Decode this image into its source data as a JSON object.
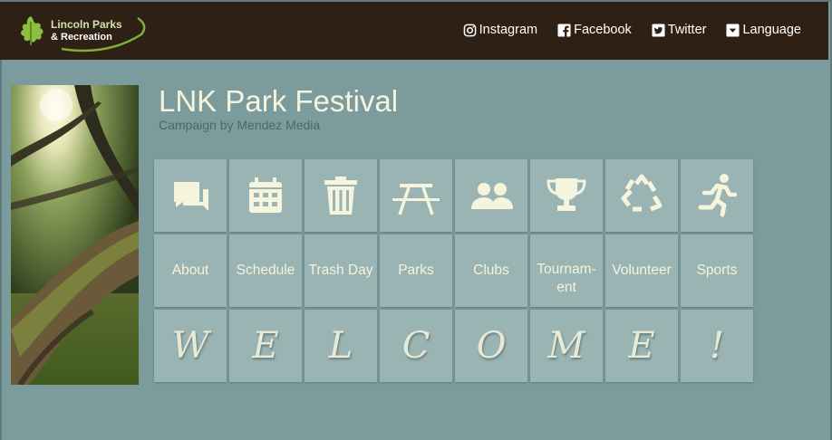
{
  "brand": {
    "line1": "Lincoln Parks",
    "line2": "& Recreation"
  },
  "nav": {
    "instagram": "Instagram",
    "facebook": "Facebook",
    "twitter": "Twitter",
    "language": "Language"
  },
  "campaign": {
    "title": "LNK Park Festival",
    "subtitle": "Campaign by Mendez Media"
  },
  "tiles": {
    "icons": [
      "chat-icon",
      "calendar-icon",
      "trash-icon",
      "picnic-table-icon",
      "group-icon",
      "trophy-icon",
      "recycle-icon",
      "runner-icon"
    ],
    "labels": [
      "About",
      "Schedule",
      "Trash Day",
      "Parks",
      "Clubs",
      "Tournam-ent",
      "Volunteer",
      "Sports"
    ],
    "tournament_line1": "Tournam-",
    "tournament_line2": "ent",
    "letters": [
      "W",
      "E",
      "L",
      "C",
      "O",
      "M",
      "E",
      "!"
    ]
  },
  "colors": {
    "header_bg": "#2f2016",
    "page_bg": "#7c9b9d",
    "tile_bg": "#9ab3b3",
    "text_cream": "#f5f4dc"
  }
}
